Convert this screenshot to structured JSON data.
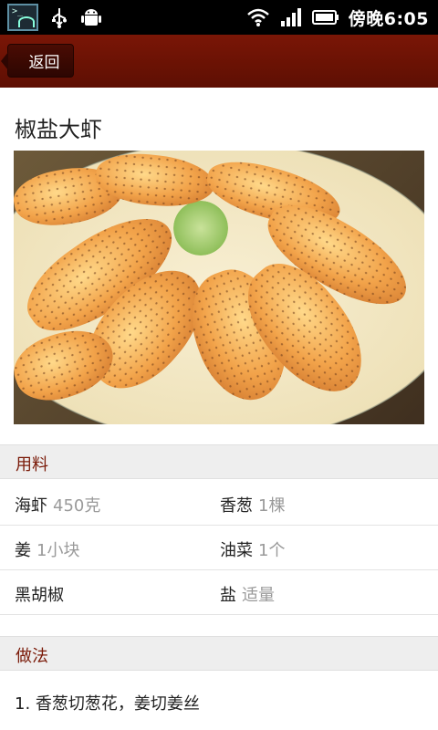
{
  "status_bar": {
    "time": "傍晚6:05",
    "left_icons": [
      "terminal-icon",
      "usb-icon",
      "android-icon"
    ],
    "right_icons": [
      "wifi-icon",
      "signal-icon",
      "battery-icon"
    ]
  },
  "title_bar": {
    "back_label": "返回"
  },
  "recipe": {
    "title": "椒盐大虾",
    "ingredients_header": "用料",
    "ingredients": [
      {
        "name": "海虾",
        "qty": "450克"
      },
      {
        "name": "香葱",
        "qty": "1棵"
      },
      {
        "name": "姜",
        "qty": "1小块"
      },
      {
        "name": "油菜",
        "qty": "1个"
      },
      {
        "name": "黑胡椒",
        "qty": ""
      },
      {
        "name": "盐",
        "qty": "适量"
      }
    ],
    "method_header": "做法",
    "steps": [
      "1. 香葱切葱花，姜切姜丝"
    ]
  },
  "colors": {
    "title_bar": "#6a1204",
    "accent_text": "#7a1a08",
    "qty_text": "#9a9a9a"
  }
}
